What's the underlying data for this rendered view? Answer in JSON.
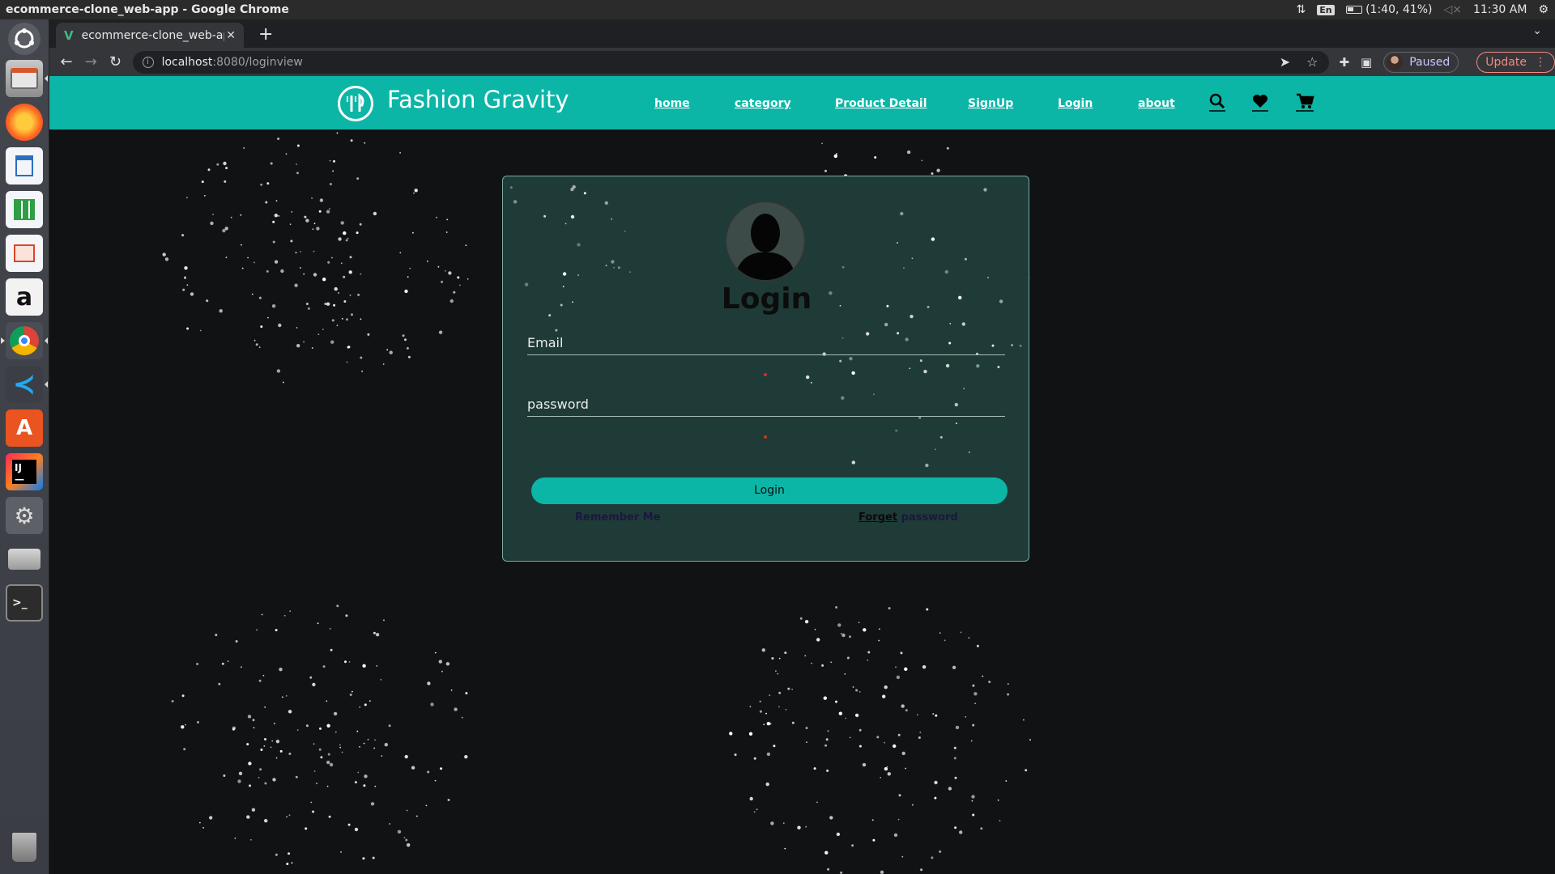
{
  "os": {
    "window_title": "ecommerce-clone_web-app - Google Chrome",
    "keyboard_layout": "En",
    "battery": "(1:40, 41%)",
    "clock": "11:30 AM"
  },
  "browser": {
    "tab_title": "ecommerce-clone_web-app",
    "url_host": "localhost",
    "url_rest": ":8080/loginview",
    "profile_status": "Paused",
    "update_label": "Update"
  },
  "navbar": {
    "brand": "Fashion Gravity",
    "links": [
      "home",
      "category",
      "Product Detail",
      "SignUp",
      "Login",
      "about"
    ],
    "icons": [
      "search-icon",
      "heart-icon",
      "cart-icon"
    ],
    "color": "#0bb6a7"
  },
  "login": {
    "title": "Login",
    "email_placeholder": "Email",
    "password_placeholder": "password",
    "button_label": "Login",
    "remember_label": "Remember Me",
    "forget_underlined": "Forget",
    "forget_rest": " password",
    "card_color": "#1f3b37"
  }
}
